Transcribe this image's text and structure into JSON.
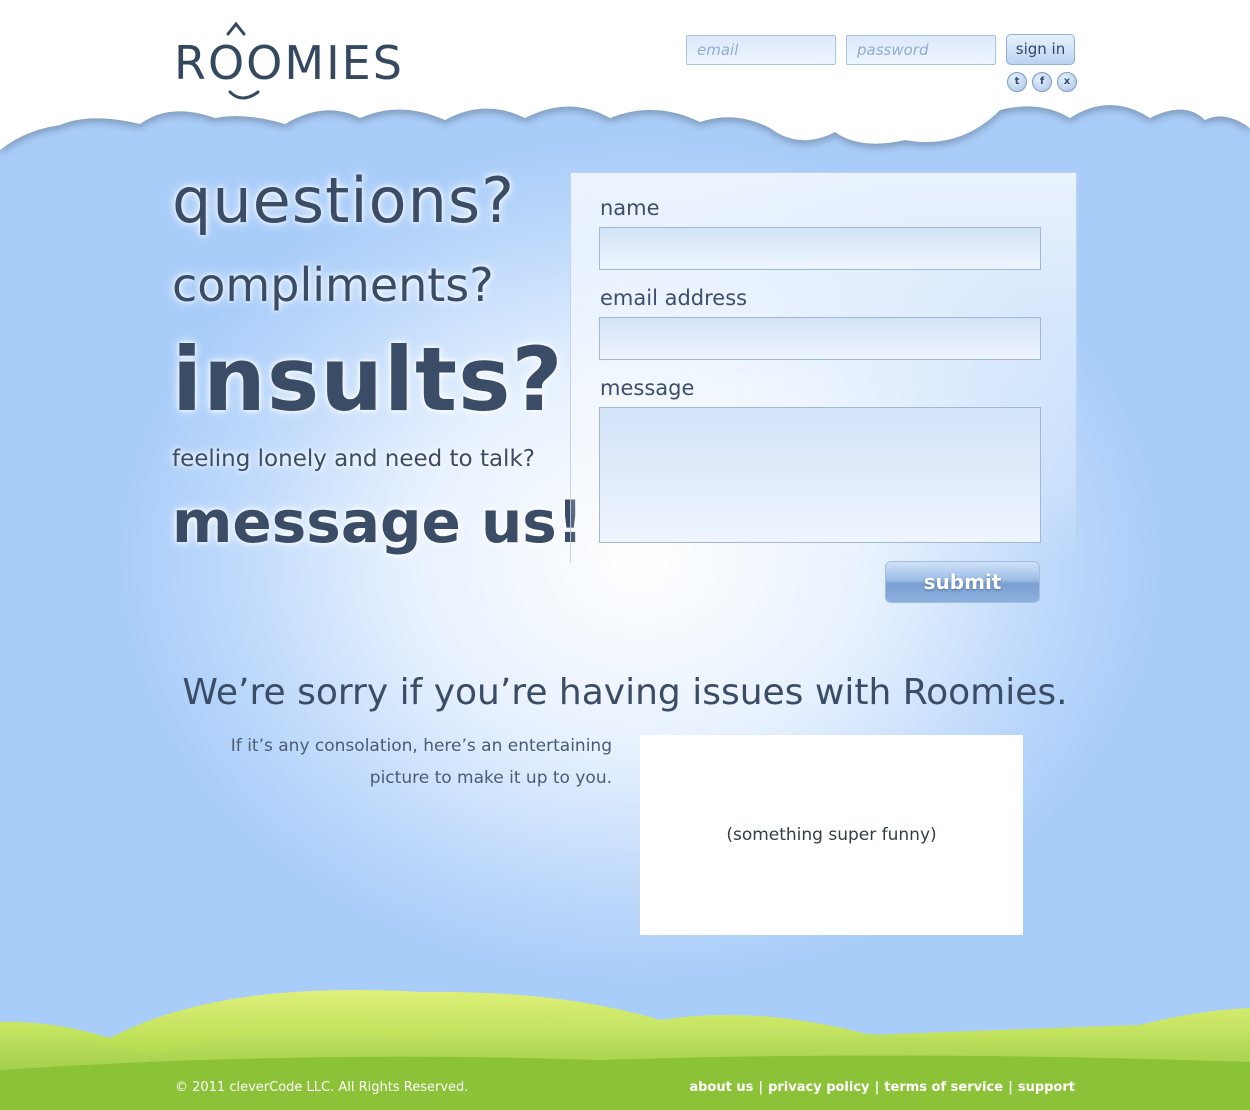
{
  "brand": {
    "logo_text": "ROOMIES"
  },
  "login": {
    "email_placeholder": "email",
    "password_placeholder": "password",
    "signin_label": "sign in",
    "social": [
      {
        "icon": "twitter-icon",
        "glyph": "t"
      },
      {
        "icon": "facebook-icon",
        "glyph": "f"
      },
      {
        "icon": "share-icon",
        "glyph": "x"
      }
    ]
  },
  "headline": {
    "line1": "questions?",
    "line2": "compliments?",
    "line3": "insults?",
    "line4": "feeling lonely and need to talk?",
    "line5": "message us!"
  },
  "form": {
    "name_label": "name",
    "email_label": "email address",
    "message_label": "message",
    "submit_label": "submit"
  },
  "sorry": {
    "title": "We’re sorry if you’re having issues with Roomies.",
    "consolation_line1": "If it’s any consolation, here’s an entertaining",
    "consolation_line2": "picture to make it up to you.",
    "picture_caption": "(something super funny)"
  },
  "footer": {
    "copyright": "© 2011 cleverCode LLC. All Rights Reserved.",
    "links": [
      "about us",
      "privacy policy",
      "terms of service",
      "support"
    ]
  },
  "colors": {
    "sky": "#a9cdf9",
    "text": "#3a4c66",
    "grass": "#9ccb3c"
  }
}
